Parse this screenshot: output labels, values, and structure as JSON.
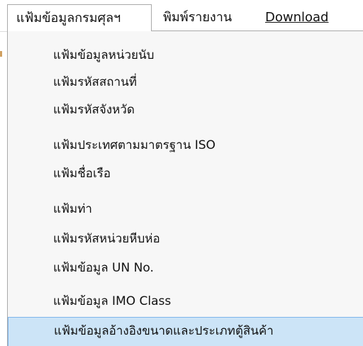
{
  "menubar": {
    "items": [
      {
        "label": "แฟ้มข้อมูลกรมศุลฯ",
        "active": true
      },
      {
        "label": "พิมพ์รายงาน",
        "active": false
      },
      {
        "label": "Download",
        "active": false
      }
    ]
  },
  "dropdown": {
    "items": [
      {
        "label": "แฟ้มข้อมูลหน่วยนับ"
      },
      {
        "label": "แฟ้มรหัสสถานที่"
      },
      {
        "label": "แฟ้มรหัสจังหวัด"
      },
      {
        "label": "แฟ้มประเทศตามมาตรฐาน ISO"
      },
      {
        "label": "แฟ้มชื่อเรือ"
      },
      {
        "label": "แฟ้มท่า"
      },
      {
        "label": "แฟ้มรหัสหน่วยหีบห่อ"
      },
      {
        "label": "แฟ้มข้อมูล UN No."
      },
      {
        "label": "แฟ้มข้อมูล IMO Class"
      },
      {
        "label": "แฟ้มข้อมูลอ้างอิงขนาดและประเภทตู้สินค้า",
        "highlighted": true
      }
    ]
  },
  "colors": {
    "highlight_bg": "#cce4f7",
    "highlight_border": "#7eb4ea",
    "dropdown_bg": "#f7f7f7"
  }
}
